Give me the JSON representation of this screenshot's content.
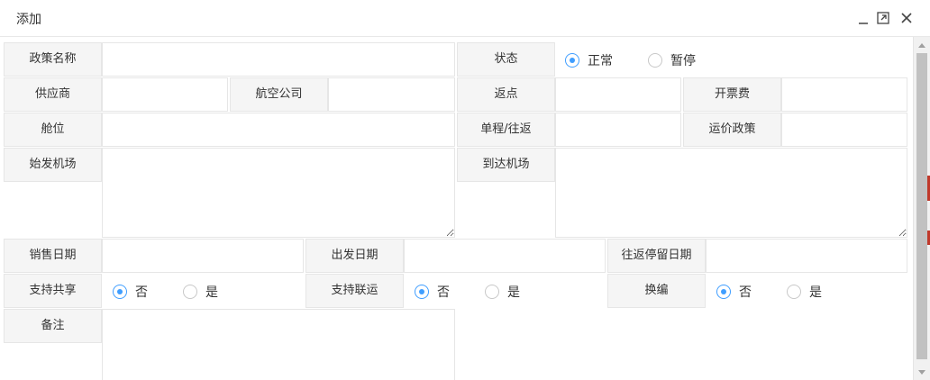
{
  "window": {
    "title": "添加",
    "icons": [
      "minimize-icon",
      "maximize-icon",
      "close-icon"
    ]
  },
  "labels": {
    "policy_name": "政策名称",
    "status": "状态",
    "supplier": "供应商",
    "airline": "航空公司",
    "rebate": "返点",
    "ticket_fee": "开票费",
    "cabin": "舱位",
    "trip_type": "单程/往返",
    "fare_policy": "运价政策",
    "origin_airport": "始发机场",
    "dest_airport": "到达机场",
    "sale_date": "销售日期",
    "depart_date": "出发日期",
    "return_stay_date": "往返停留日期",
    "support_share": "支持共享",
    "support_interline": "支持联运",
    "rebook": "换编",
    "remark": "备注"
  },
  "options": {
    "status": [
      "正常",
      "暂停"
    ],
    "yes_no": [
      "否",
      "是"
    ]
  },
  "selected": {
    "status": "正常",
    "support_share": "否",
    "support_interline": "否",
    "rebook": "否"
  },
  "colors": {
    "accent": "#409eff",
    "label_bg": "#f5f5f5",
    "border": "#e6e6e6"
  }
}
